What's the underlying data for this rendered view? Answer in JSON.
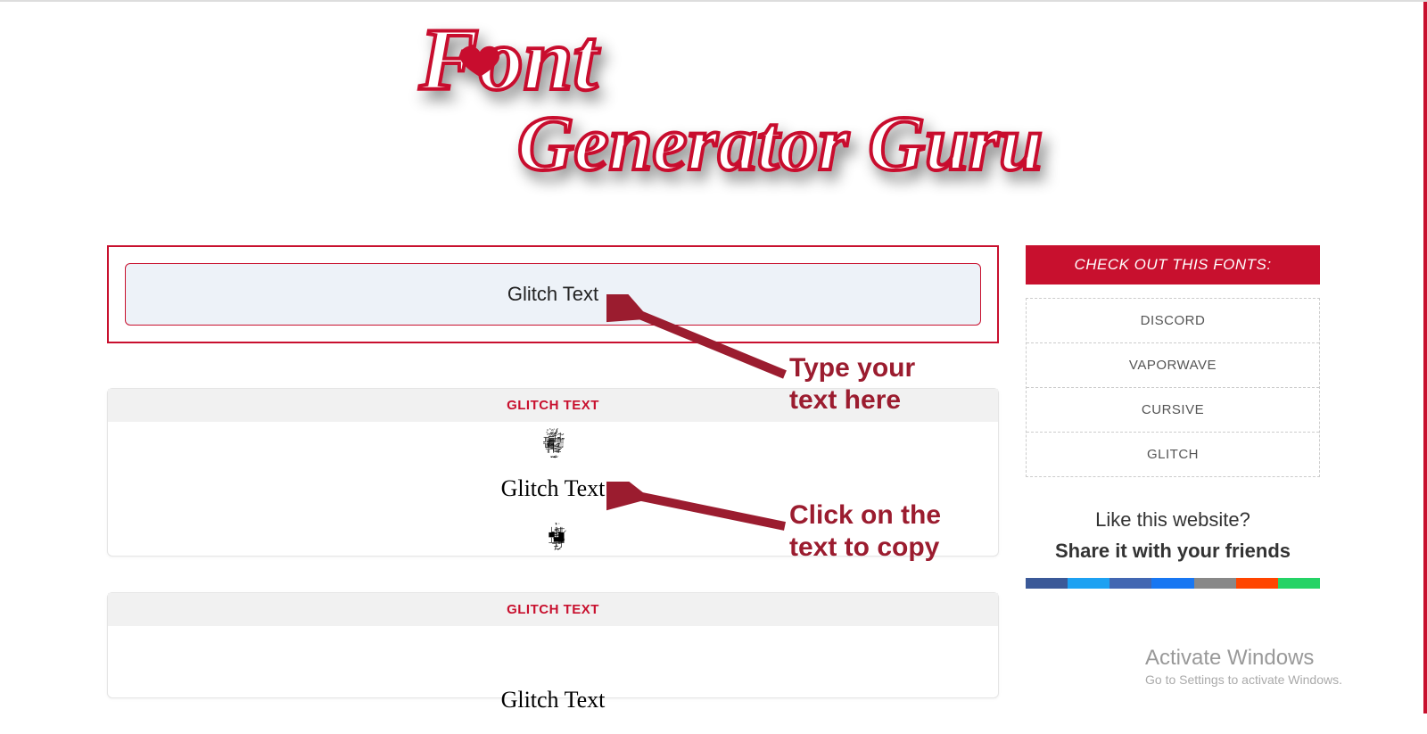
{
  "logo": {
    "line1": "Font",
    "line2": "Generator Guru"
  },
  "input": {
    "value": "Glitch Text"
  },
  "results": [
    {
      "header": "GLITCH TEXT",
      "text": "Glitch Text"
    },
    {
      "header": "GLITCH TEXT",
      "text": "Glitch Text"
    }
  ],
  "sidebar": {
    "title": "CHECK OUT THIS FONTS:",
    "links": [
      "DISCORD",
      "VAPORWAVE",
      "CURSIVE",
      "GLITCH"
    ],
    "share": {
      "line1": "Like this website?",
      "line2": "Share it with your friends"
    }
  },
  "annotations": {
    "type_here": "Type your\ntext here",
    "click_copy": "Click on the\ntext to copy"
  },
  "watermark": {
    "title": "Activate Windows",
    "sub": "Go to Settings to activate Windows."
  },
  "social_colors": [
    "#3b5998",
    "#1da1f2",
    "#4267B2",
    "#1877f2",
    "#888888",
    "#ff4500",
    "#25d366"
  ]
}
